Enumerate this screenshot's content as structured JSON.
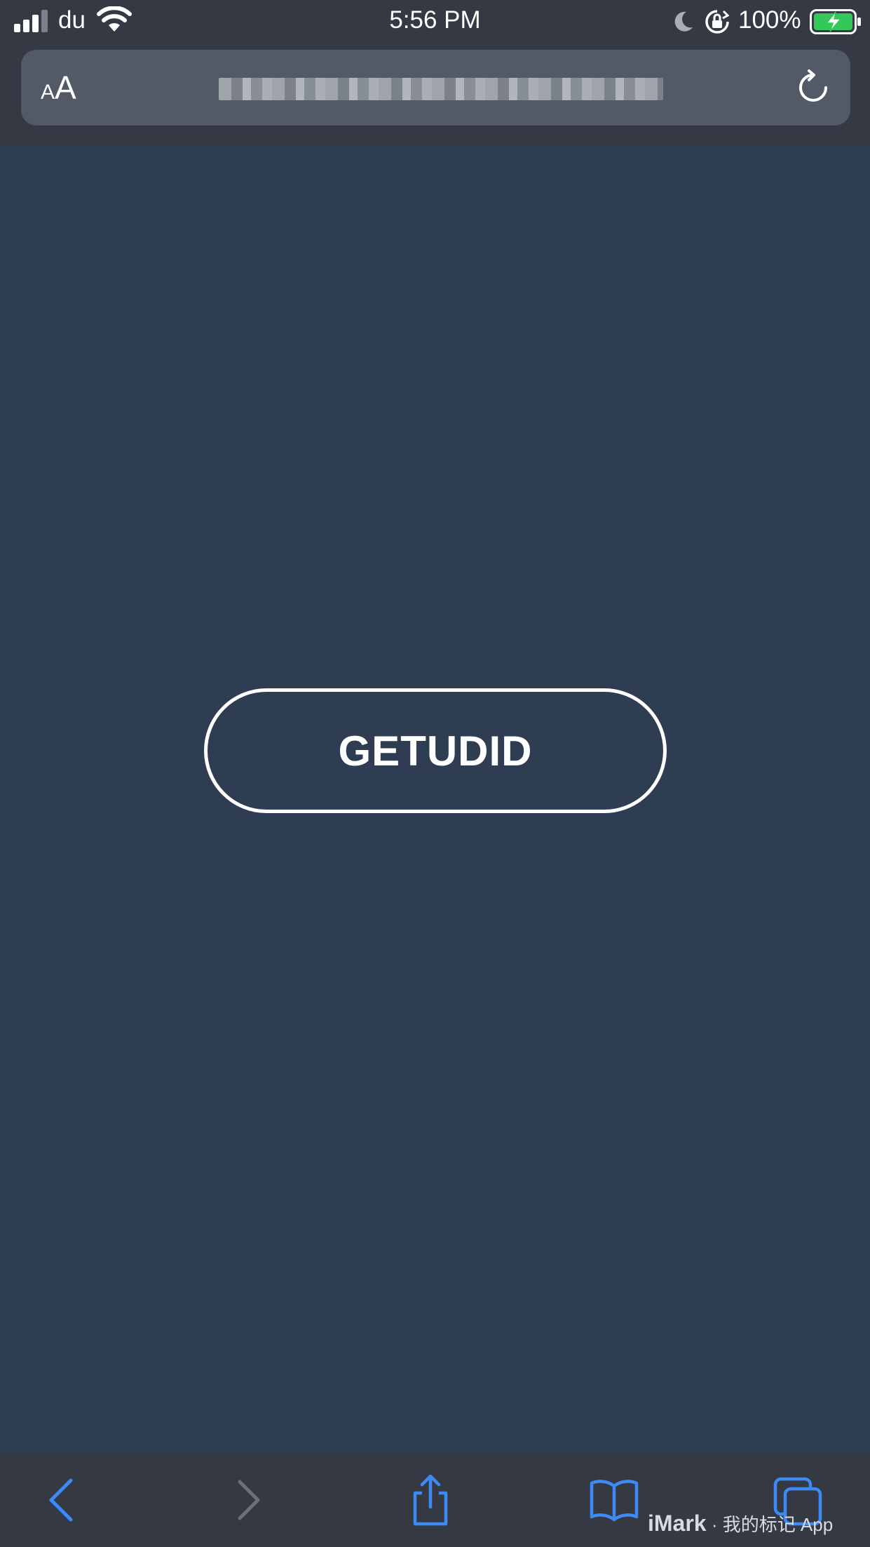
{
  "status_bar": {
    "carrier": "du",
    "time": "5:56 PM",
    "battery_percent": "100%",
    "icons": [
      "signal-icon",
      "wifi-icon",
      "moon-icon",
      "rotation-lock-icon",
      "battery-charging-icon"
    ]
  },
  "address_bar": {
    "text_size_label": "AA",
    "url": "",
    "reload_icon": "reload-icon"
  },
  "main": {
    "button_label": "GETUDID"
  },
  "toolbar": {
    "icons": [
      "back-icon",
      "forward-icon",
      "share-icon",
      "bookmarks-icon",
      "tabs-icon"
    ]
  },
  "watermark": {
    "brand": "iMark",
    "text": "· 我的标记 App"
  },
  "colors": {
    "page_background": "#2e3d52",
    "chrome_background": "#343943",
    "address_bar_background": "#515a66",
    "accent_blue": "#3d8af7",
    "battery_green": "#34c759"
  }
}
